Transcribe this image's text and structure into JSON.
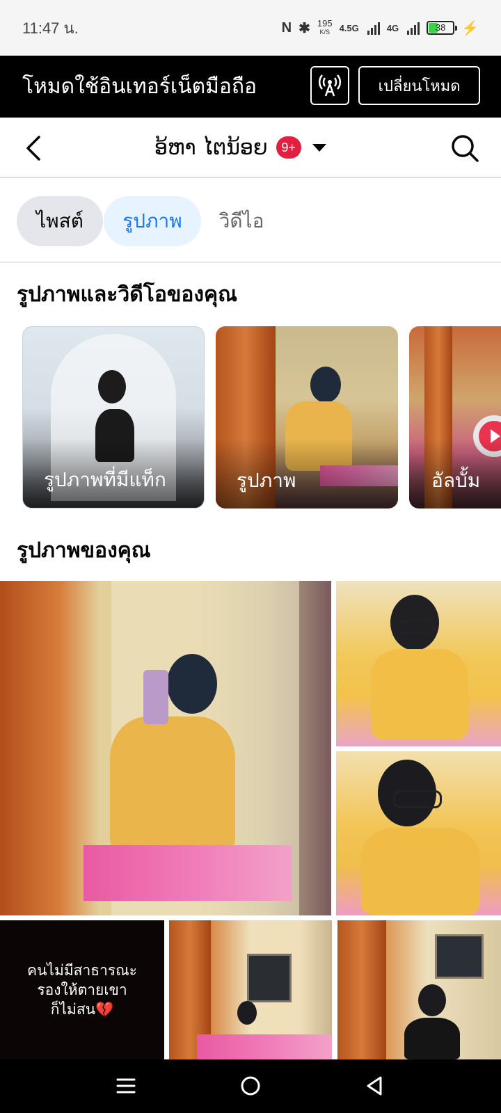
{
  "status_bar": {
    "time": "11:47 น.",
    "net_speed_value": "195",
    "net_speed_unit": "K/S",
    "signal_1": "4.5G",
    "signal_2": "4G",
    "battery_level": "38",
    "battery_percent": 38,
    "battery_color": "#3bd24a"
  },
  "mode_banner": {
    "text": "โหมดใช้อินเทอร์เน็ตมือถือ",
    "switch_label": "เปลี่ยนโหมด",
    "broadcast_icon": "broadcast-tower-icon"
  },
  "header": {
    "profile_name": "ອ້ຫາ ໄຕນ້ອຍ",
    "notification_badge": "9+",
    "badge_color": "#e41e3f",
    "back_icon": "chevron-left-icon",
    "search_icon": "search-icon",
    "dropdown_icon": "caret-down-icon"
  },
  "tabs": [
    {
      "label": "ไพสต์",
      "selected": false
    },
    {
      "label": "รูปภาพ",
      "selected": true
    },
    {
      "label": "วิดีไอ",
      "selected": false
    }
  ],
  "accent_color": "#1877f2",
  "sections": {
    "albums_title": "รูปภาพและวิดีโอของคุณ",
    "photos_title": "รูปภาพของคุณ"
  },
  "albums": [
    {
      "label": "รูปภาพที่มีแท็ก"
    },
    {
      "label": "รูปภาพ"
    },
    {
      "label": "อัลบั้ม"
    }
  ],
  "photos": {
    "text_post": "คนไม่มีสาธารณะ\nรองให้ตายเขา\nก็ไม่สน💔"
  },
  "bottom_nav": {
    "menu_icon": "menu-lines-icon",
    "home_icon": "home-circle-icon",
    "back_icon": "back-triangle-icon"
  }
}
